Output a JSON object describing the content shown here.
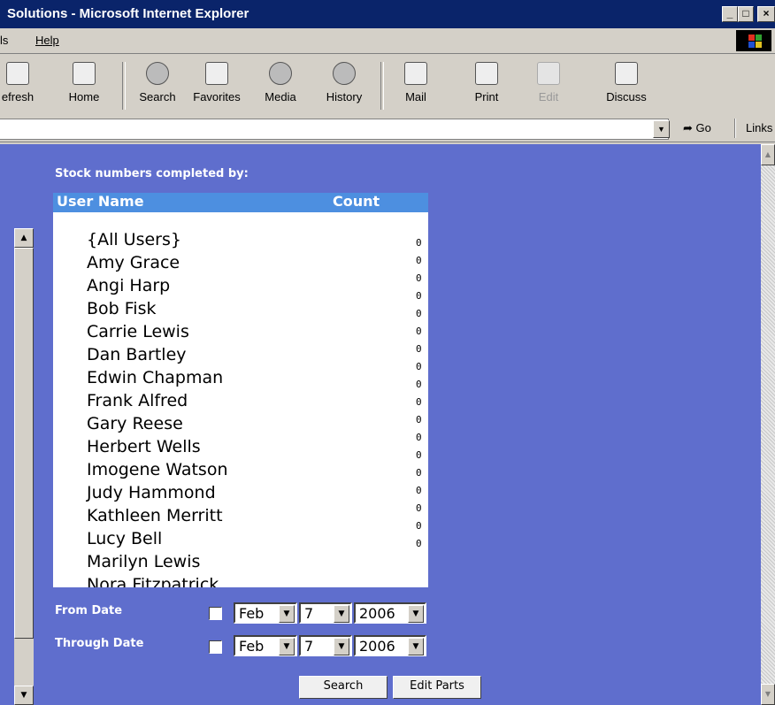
{
  "window": {
    "title": "Solutions - Microsoft Internet Explorer"
  },
  "menu": {
    "items": [
      "ls",
      "Help"
    ]
  },
  "toolbar": {
    "buttons": [
      {
        "label": "efresh",
        "icon": "refresh-icon"
      },
      {
        "label": "Home",
        "icon": "home-icon"
      },
      {
        "label": "Search",
        "icon": "search-icon"
      },
      {
        "label": "Favorites",
        "icon": "favorites-icon"
      },
      {
        "label": "Media",
        "icon": "media-icon"
      },
      {
        "label": "History",
        "icon": "history-icon"
      },
      {
        "label": "Mail",
        "icon": "mail-icon"
      },
      {
        "label": "Print",
        "icon": "print-icon"
      },
      {
        "label": "Edit",
        "icon": "edit-icon"
      },
      {
        "label": "Discuss",
        "icon": "discuss-icon"
      }
    ]
  },
  "address": {
    "go_label": "Go",
    "links_label": "Links"
  },
  "form": {
    "heading": "Stock numbers completed by:",
    "columns": {
      "user": "User Name",
      "count": "Count"
    },
    "users": [
      {
        "name": "{All Users}",
        "count": "0"
      },
      {
        "name": "Amy Grace",
        "count": "0"
      },
      {
        "name": "Angi Harp",
        "count": "0"
      },
      {
        "name": "Bob Fisk",
        "count": "0"
      },
      {
        "name": "Carrie Lewis",
        "count": "0"
      },
      {
        "name": "Dan Bartley",
        "count": "0"
      },
      {
        "name": "Edwin Chapman",
        "count": "0"
      },
      {
        "name": "Frank Alfred",
        "count": "0"
      },
      {
        "name": "Gary Reese",
        "count": "0"
      },
      {
        "name": "Herbert Wells",
        "count": "0"
      },
      {
        "name": "Imogene Watson",
        "count": "0"
      },
      {
        "name": "Judy Hammond",
        "count": "0"
      },
      {
        "name": "Kathleen Merritt",
        "count": "0"
      },
      {
        "name": "Lucy Bell",
        "count": "0"
      },
      {
        "name": "Marilyn Lewis",
        "count": "0"
      },
      {
        "name": "Nora Fitzpatrick",
        "count": ""
      }
    ],
    "extra_counts": [
      "0",
      "0",
      "0",
      "0",
      "0",
      "0",
      "0",
      "0",
      "0",
      "0",
      "0",
      "0",
      "0",
      "0",
      "0",
      "0",
      "0",
      "0"
    ],
    "from_date": {
      "label": "From Date",
      "month": "Feb",
      "day": "7",
      "year": "2006"
    },
    "through_date": {
      "label": "Through Date",
      "month": "Feb",
      "day": "7",
      "year": "2006"
    },
    "search_label": "Search",
    "edit_parts_label": "Edit Parts"
  },
  "colors": {
    "titlebar": "#0a246a",
    "content_bg": "#5f6ecd",
    "list_header": "#4d8fe0"
  }
}
